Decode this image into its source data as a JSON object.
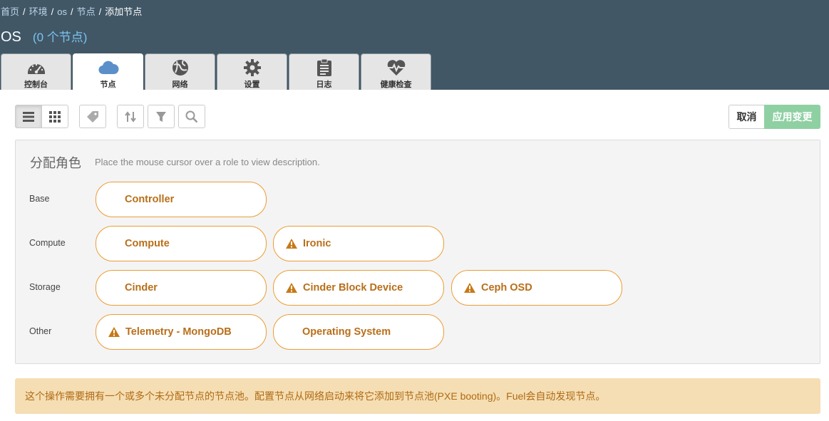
{
  "breadcrumb": {
    "home": "首页",
    "environments": "环境",
    "env": "os",
    "nodes": "节点",
    "current": "添加节点",
    "separator": "/"
  },
  "env_title": "OS",
  "node_count": "(0 个节点)",
  "tabs": [
    {
      "label": "控制台",
      "icon": "dashboard-icon"
    },
    {
      "label": "节点",
      "icon": "cloud-icon"
    },
    {
      "label": "网络",
      "icon": "globe-icon"
    },
    {
      "label": "设置",
      "icon": "gear-icon"
    },
    {
      "label": "日志",
      "icon": "clipboard-icon"
    },
    {
      "label": "健康检查",
      "icon": "heart-pulse-icon"
    }
  ],
  "toolbar": {
    "cancel_label": "取消",
    "apply_label": "应用变更"
  },
  "roles": {
    "title": "分配角色",
    "hint": "Place the mouse cursor over a role to view description.",
    "groups": [
      {
        "label": "Base",
        "items": [
          {
            "label": "Controller",
            "warning": false
          }
        ]
      },
      {
        "label": "Compute",
        "items": [
          {
            "label": "Compute",
            "warning": false
          },
          {
            "label": "Ironic",
            "warning": true
          }
        ]
      },
      {
        "label": "Storage",
        "items": [
          {
            "label": "Cinder",
            "warning": false
          },
          {
            "label": "Cinder Block Device",
            "warning": true
          },
          {
            "label": "Ceph OSD",
            "warning": true
          }
        ]
      },
      {
        "label": "Other",
        "items": [
          {
            "label": "Telemetry - MongoDB",
            "warning": true
          },
          {
            "label": "Operating System",
            "warning": false
          }
        ]
      }
    ]
  },
  "alert": {
    "message": "这个操作需要拥有一个或多个未分配节点的节点池。配置节点从网络启动来将它添加到节点池(PXE booting)。Fuel会自动发现节点。"
  },
  "colors": {
    "header_bg": "#415766",
    "accent_orange": "#ec9c34",
    "apply_green": "#8fd0a3",
    "alert_bg": "#f5deb3"
  }
}
